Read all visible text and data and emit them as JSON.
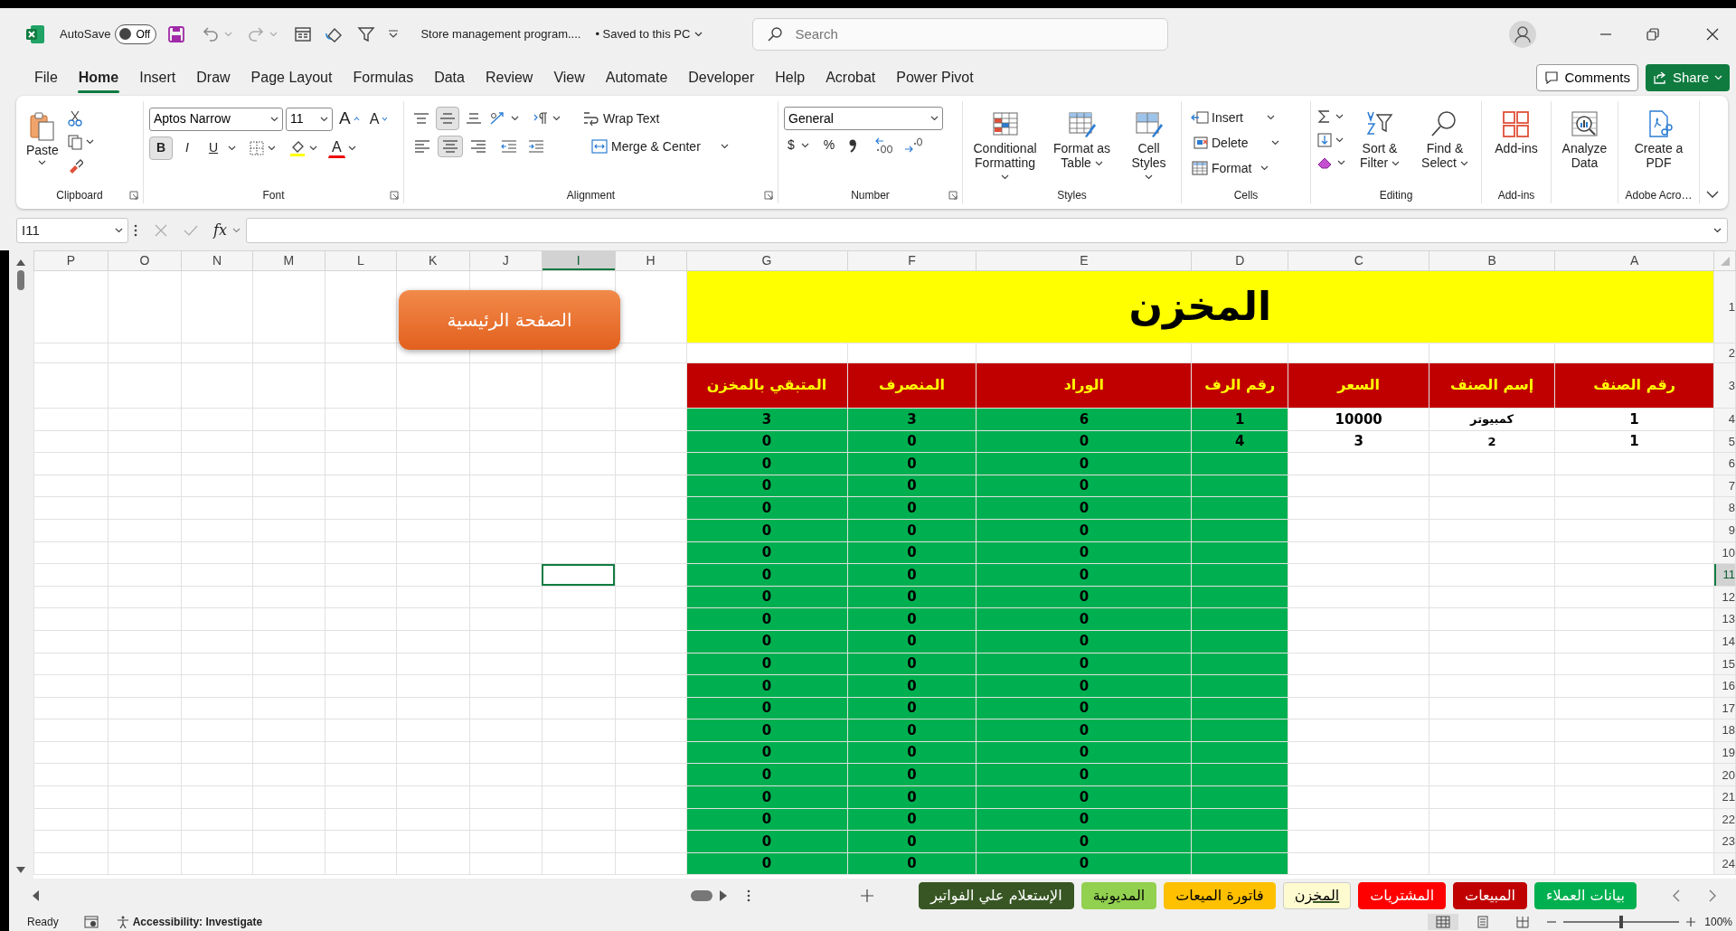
{
  "title_bar": {
    "autosave_label": "AutoSave",
    "autosave_state": "Off",
    "autosave_on": false,
    "document_title": "Store management program....",
    "save_status": "• Saved to this PC",
    "search_placeholder": "Search"
  },
  "menu_tabs": [
    {
      "label": "File",
      "selected": false
    },
    {
      "label": "Home",
      "selected": true
    },
    {
      "label": "Insert",
      "selected": false
    },
    {
      "label": "Draw",
      "selected": false
    },
    {
      "label": "Page Layout",
      "selected": false
    },
    {
      "label": "Formulas",
      "selected": false
    },
    {
      "label": "Data",
      "selected": false
    },
    {
      "label": "Review",
      "selected": false
    },
    {
      "label": "View",
      "selected": false
    },
    {
      "label": "Automate",
      "selected": false
    },
    {
      "label": "Developer",
      "selected": false
    },
    {
      "label": "Help",
      "selected": false
    },
    {
      "label": "Acrobat",
      "selected": false
    },
    {
      "label": "Power Pivot",
      "selected": false
    }
  ],
  "comments_button": "Comments",
  "share_button": "Share",
  "ribbon": [
    {
      "kind": "clipboard",
      "label": "Clipboard",
      "paste": "Paste"
    },
    {
      "kind": "font",
      "label": "Font",
      "font_name": "Aptos Narrow",
      "font_size": "11",
      "grow_font": "A",
      "shrink_font": "A",
      "styles": [
        {
          "text": "B",
          "selected": true
        },
        {
          "text": "I",
          "selected": false
        },
        {
          "text": "U",
          "selected": false
        }
      ],
      "font_color": "A"
    },
    {
      "kind": "alignment",
      "label": "Alignment",
      "vertical_align": [
        {
          "selected": false
        },
        {
          "selected": true
        },
        {
          "selected": false
        }
      ],
      "horizontal_align": [
        {
          "selected": false
        },
        {
          "selected": true
        },
        {
          "selected": false
        }
      ],
      "wrap_text": "Wrap Text",
      "merge_center": "Merge & Center"
    },
    {
      "kind": "number",
      "label": "Number",
      "format": "General",
      "currency": "$",
      "percent": "%"
    },
    {
      "kind": "large",
      "label": "Styles",
      "buttons": [
        {
          "kind": "conditional",
          "text": "Conditional Formatting",
          "dropdown": true
        },
        {
          "kind": "table",
          "text": "Format as Table",
          "dropdown": true
        },
        {
          "kind": "cell-styles",
          "text": "Cell Styles",
          "dropdown": true
        }
      ]
    },
    {
      "kind": "cells",
      "label": "Cells",
      "buttons": [
        "Insert",
        "Delete",
        "Format"
      ]
    },
    {
      "kind": "editing",
      "label": "Editing",
      "buttons": [
        {
          "kind": "sort",
          "text": "Sort & Filter",
          "dropdown": true
        },
        {
          "kind": "find",
          "text": "Find & Select",
          "dropdown": true
        }
      ]
    },
    {
      "kind": "large",
      "label": "Add-ins",
      "buttons": [
        {
          "kind": "addins",
          "text": "Add-ins",
          "dropdown": false
        }
      ]
    },
    {
      "kind": "large",
      "buttons": [
        {
          "kind": "analyze",
          "text": "Analyze Data",
          "dropdown": false
        }
      ]
    },
    {
      "kind": "large",
      "label": "Adobe Acro…",
      "buttons": [
        {
          "kind": "pdf",
          "text": "Create a PDF",
          "dropdown": false
        }
      ]
    }
  ],
  "formula_bar": {
    "name_box": "I11",
    "function_symbol": "fx"
  },
  "sheet": {
    "columns": [
      {
        "letter": "P",
        "selected": false
      },
      {
        "letter": "O",
        "selected": false
      },
      {
        "letter": "N",
        "selected": false
      },
      {
        "letter": "M",
        "selected": false
      },
      {
        "letter": "L",
        "selected": false
      },
      {
        "letter": "K",
        "selected": false
      },
      {
        "letter": "J",
        "selected": false
      },
      {
        "letter": "I",
        "selected": true
      },
      {
        "letter": "H",
        "selected": false
      },
      {
        "letter": "G",
        "selected": false
      },
      {
        "letter": "F",
        "selected": false
      },
      {
        "letter": "E",
        "selected": false
      },
      {
        "letter": "D",
        "selected": false
      },
      {
        "letter": "C",
        "selected": false
      },
      {
        "letter": "B",
        "selected": false
      },
      {
        "letter": "A",
        "selected": false
      }
    ],
    "title_row": "1",
    "title": "المخزن",
    "blank_row": "2",
    "header_row": "3",
    "headers": [
      "رقم الصنف",
      "إسم الصنف",
      "السعر",
      "رقم الرف",
      "الوراد",
      "المنصرف",
      "المتبقي بالمخزن"
    ],
    "rows": [
      {
        "number": "4",
        "selected": false,
        "item_no": "1",
        "item_name": "كمبيوتر",
        "price": "10000",
        "shelf_no": "1",
        "incoming": "6",
        "outgoing": "3",
        "remaining": "3"
      },
      {
        "number": "5",
        "selected": false,
        "item_no": "1",
        "item_name": "2",
        "price": "3",
        "shelf_no": "4",
        "incoming": "0",
        "outgoing": "0",
        "remaining": "0"
      },
      {
        "number": "6",
        "selected": false,
        "incoming": "0",
        "outgoing": "0",
        "remaining": "0"
      },
      {
        "number": "7",
        "selected": false,
        "incoming": "0",
        "outgoing": "0",
        "remaining": "0"
      },
      {
        "number": "8",
        "selected": false,
        "incoming": "0",
        "outgoing": "0",
        "remaining": "0"
      },
      {
        "number": "9",
        "selected": false,
        "incoming": "0",
        "outgoing": "0",
        "remaining": "0"
      },
      {
        "number": "10",
        "selected": false,
        "incoming": "0",
        "outgoing": "0",
        "remaining": "0"
      },
      {
        "number": "11",
        "selected": true,
        "incoming": "0",
        "outgoing": "0",
        "remaining": "0"
      },
      {
        "number": "12",
        "selected": false,
        "incoming": "0",
        "outgoing": "0",
        "remaining": "0"
      },
      {
        "number": "13",
        "selected": false,
        "incoming": "0",
        "outgoing": "0",
        "remaining": "0"
      },
      {
        "number": "14",
        "selected": false,
        "incoming": "0",
        "outgoing": "0",
        "remaining": "0"
      },
      {
        "number": "15",
        "selected": false,
        "incoming": "0",
        "outgoing": "0",
        "remaining": "0"
      },
      {
        "number": "16",
        "selected": false,
        "incoming": "0",
        "outgoing": "0",
        "remaining": "0"
      },
      {
        "number": "17",
        "selected": false,
        "incoming": "0",
        "outgoing": "0",
        "remaining": "0"
      },
      {
        "number": "18",
        "selected": false,
        "incoming": "0",
        "outgoing": "0",
        "remaining": "0"
      },
      {
        "number": "19",
        "selected": false,
        "incoming": "0",
        "outgoing": "0",
        "remaining": "0"
      },
      {
        "number": "20",
        "selected": false,
        "incoming": "0",
        "outgoing": "0",
        "remaining": "0"
      },
      {
        "number": "21",
        "selected": false,
        "incoming": "0",
        "outgoing": "0",
        "remaining": "0"
      },
      {
        "number": "22",
        "selected": false,
        "incoming": "0",
        "outgoing": "0",
        "remaining": "0"
      },
      {
        "number": "23",
        "selected": false,
        "incoming": "0",
        "outgoing": "0",
        "remaining": "0"
      },
      {
        "number": "24",
        "selected": false,
        "incoming": "0",
        "outgoing": "0",
        "remaining": "0"
      }
    ],
    "home_button": "الصفحة الرئيسية"
  },
  "sheet_tabs": [
    {
      "label": "بيانات العملاء",
      "color": "#00b050",
      "selected": false
    },
    {
      "label": "المبيعات",
      "color": "#c00000",
      "selected": false
    },
    {
      "label": "المشتريات",
      "color": "#ff0000",
      "selected": false
    },
    {
      "label": "المخزن",
      "color": "#fffbd0",
      "selected": true
    },
    {
      "label": "فاتورة الميعات",
      "color": "#ffc000",
      "selected": false
    },
    {
      "label": "المديونية",
      "color": "#92d050",
      "selected": false
    },
    {
      "label": "الإستعلام علي الفواتير",
      "color": "#375623",
      "selected": false
    }
  ],
  "status_bar": {
    "ready": "Ready",
    "accessibility": "Accessibility: Investigate",
    "views": [
      {
        "selected": true
      },
      {
        "selected": false
      },
      {
        "selected": false
      }
    ],
    "zoom_slider": {
      "level": 0.5
    },
    "zoom": "100%"
  }
}
